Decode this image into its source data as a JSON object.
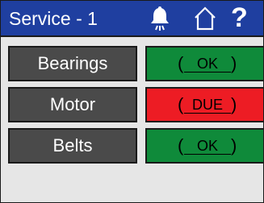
{
  "header": {
    "title": "Service - 1",
    "icons": [
      "bell-icon",
      "home-icon",
      "help-icon"
    ],
    "help_glyph": "?"
  },
  "colors": {
    "header_bg": "#1f3fa0",
    "label_bg": "#4a4a4a",
    "ok": "#0f8a3a",
    "due": "#ed1c24",
    "panel_bg": "#e6e6e6"
  },
  "items": [
    {
      "label": "Bearings",
      "paren_open": "(",
      "status": "OK",
      "paren_close": ")",
      "state": "ok"
    },
    {
      "label": "Motor",
      "paren_open": "(",
      "status": "DUE",
      "paren_close": ")",
      "state": "due"
    },
    {
      "label": "Belts",
      "paren_open": "(",
      "status": "OK",
      "paren_close": ")",
      "state": "ok"
    }
  ]
}
